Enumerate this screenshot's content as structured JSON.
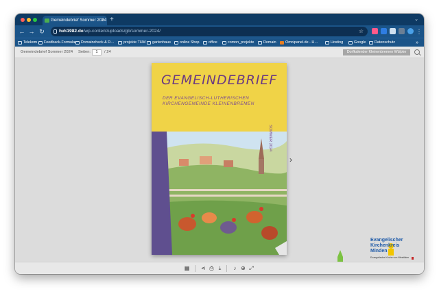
{
  "browser": {
    "tab_title": "Gemeindebrief Sommer 2024",
    "tab_close": "×",
    "new_tab": "+",
    "url_host": "hvk1982.de",
    "url_path": "/wp-content/uploads/gb/sommer-2024/",
    "bookmarks": [
      "Telekom",
      "Feedback-Formular",
      "Domaincheck & D…",
      "projekte THM",
      "gartenhaus",
      "online Shop",
      "office",
      "comon_projekte",
      "Domain",
      "Omnipanel.de - H…",
      "Hosting",
      "Google",
      "Datenschutz"
    ],
    "bookmarks_more": "»"
  },
  "viewer": {
    "doc_title": "Gemeindebrief Sommer 2024",
    "pages_label": "Seiten:",
    "current_page": "1",
    "total_pages": "/ 24",
    "next_doc_button": "Dorfkalender Kleinenbremen Wülpke"
  },
  "cover": {
    "title": "GEMEINDEBRIEF",
    "subtitle_line1": "DER EVANGELISCH-LUTHERISCHEN",
    "subtitle_line2": "KIRCHENGEMEINDE KLEINENBREMEN",
    "season": "SOMMER 2024"
  },
  "logo": {
    "line1": "Evangelischer",
    "line2": "Kirchenkreis",
    "line3": "Minden",
    "tagline": "Evangelische Kirche von Westfalen"
  },
  "colors": {
    "tabstrip": "#0e3a63",
    "toolbar": "#1b5488",
    "cover_yellow": "#f0d347",
    "title_purple": "#6b3a82",
    "logo_blue": "#1e5aa8",
    "logo_green": "#7cc242"
  },
  "icons": {
    "back": "back-arrow-icon",
    "forward": "forward-arrow-icon",
    "reload": "reload-icon",
    "star": "bookmark-star-icon",
    "search": "search-icon",
    "grid": "thumbnails-grid-icon",
    "share": "share-icon",
    "print": "print-icon",
    "download": "download-icon",
    "sound": "sound-icon",
    "zoom": "zoom-in-icon",
    "fullscreen": "fullscreen-icon"
  }
}
